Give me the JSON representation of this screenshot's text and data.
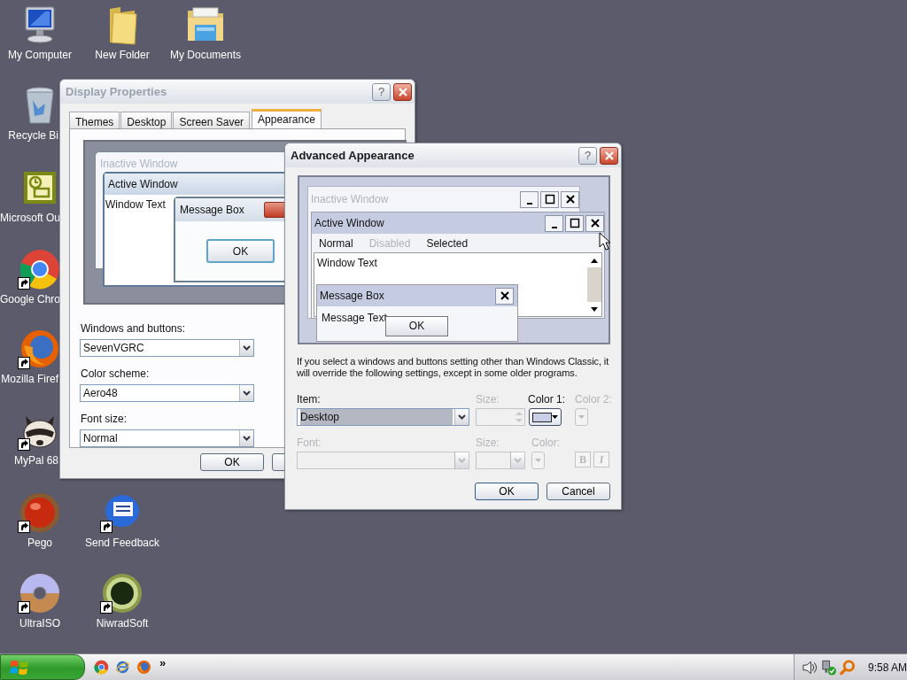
{
  "desktop_icons": [
    {
      "label": "My Computer",
      "kind": "computer",
      "shortcut": false
    },
    {
      "label": "New Folder",
      "kind": "folder",
      "shortcut": false
    },
    {
      "label": "My Documents",
      "kind": "documents",
      "shortcut": false
    },
    {
      "label": "Recycle Bi",
      "kind": "recycle",
      "shortcut": false
    },
    {
      "label": "Microsoft Ou",
      "kind": "outlook",
      "shortcut": false
    },
    {
      "label": "Google Chro",
      "kind": "chrome",
      "shortcut": true
    },
    {
      "label": "Mozilla Firef",
      "kind": "firefox",
      "shortcut": true
    },
    {
      "label": "MyPal 68",
      "kind": "mypal",
      "shortcut": true
    },
    {
      "label": "Pego",
      "kind": "pego",
      "shortcut": true
    },
    {
      "label": "Send Feedback",
      "kind": "feedback",
      "shortcut": true
    },
    {
      "label": "UltraISO",
      "kind": "disc",
      "shortcut": true
    },
    {
      "label": "NiwradSoft",
      "kind": "niwrad",
      "shortcut": true
    }
  ],
  "display_properties": {
    "title": "Display Properties",
    "active": false,
    "help": "?",
    "tabs": [
      {
        "label": "Themes",
        "selected": false
      },
      {
        "label": "Desktop",
        "selected": false
      },
      {
        "label": "Screen Saver",
        "selected": false
      },
      {
        "label": "Appearance",
        "selected": true
      }
    ],
    "preview": {
      "inactive_title": "Inactive Window",
      "active_title": "Active Window",
      "window_text": "Window Text",
      "message_title": "Message Box",
      "ok": "OK"
    },
    "fields": [
      {
        "label": "Windows and buttons:",
        "value": "SevenVGRC"
      },
      {
        "label": "Color scheme:",
        "value": "Aero48"
      },
      {
        "label": "Font size:",
        "value": "Normal"
      }
    ],
    "buttons": [
      "OK"
    ]
  },
  "advanced_appearance": {
    "title": "Advanced Appearance",
    "active": true,
    "help": "?",
    "preview": {
      "inactive_title": "Inactive Window",
      "active_title": "Active Window",
      "menu": [
        {
          "label": "Normal",
          "disabled": false
        },
        {
          "label": "Disabled",
          "disabled": true
        },
        {
          "label": "Selected",
          "disabled": false
        }
      ],
      "window_text": "Window Text",
      "message_title": "Message Box",
      "message_text": "Message Text",
      "ok": "OK"
    },
    "note": "If you select a windows and buttons setting other than Windows Classic, it will override the following settings, except in some older programs.",
    "controls": [
      {
        "kind": "select",
        "label": "Item:",
        "value": "Desktop",
        "disabled": false
      },
      {
        "kind": "spin",
        "label": "Size:",
        "disabled": true
      },
      {
        "kind": "color",
        "label": "Color 1:",
        "color": "#c8cfe6",
        "disabled": false
      },
      {
        "kind": "color",
        "label": "Color 2:",
        "disabled": true
      },
      {
        "kind": "select",
        "label": "Font:",
        "disabled": true
      },
      {
        "kind": "select",
        "label": "Size:",
        "disabled": true
      },
      {
        "kind": "color",
        "label": "Color:",
        "disabled": true
      },
      {
        "kind": "toggles",
        "labels": [
          "B",
          "I"
        ],
        "disabled": true
      }
    ],
    "buttons": [
      "OK",
      "Cancel"
    ]
  },
  "taskbar": {
    "more": "»",
    "time": "9:58 AM"
  }
}
